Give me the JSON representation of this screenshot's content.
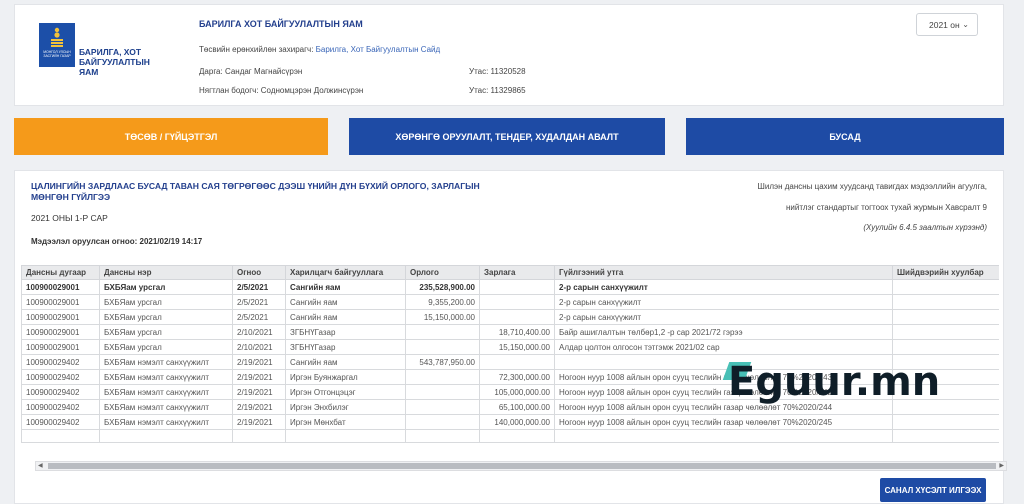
{
  "header": {
    "logo_text_1": "БАРИЛГА, ХОТ",
    "logo_text_2": "БАЙГУУЛАЛТЫН ЯАМ",
    "emblem_text": "МОНГОЛ УЛСЫН ЗАСГИЙН ГАЗАР",
    "org_name": "БАРИЛГА ХОТ БАЙГУУЛАЛТЫН ЯАМ",
    "manager_label": "Төсвийн ерөнхийлөн захирагч:",
    "manager_value": "Барилга, Хот Байгуулалтын Сайд",
    "head_label": "Дарга: Сандаг Магнайсүрэн",
    "head_phone": "Утас: 11320528",
    "accountant_label": "Нягтлан бодогч: Содномцэрэн Должинсүрэн",
    "accountant_phone": "Утас: 11329865",
    "year_value": "2021 он"
  },
  "tabs": [
    {
      "label": "ТӨСӨВ / ГҮЙЦЭТГЭЛ"
    },
    {
      "label": "ХӨРӨНГӨ ОРУУЛАЛТ, ТЕНДЕР, ХУДАЛДАН АВАЛТ"
    },
    {
      "label": "БУСАД"
    }
  ],
  "main": {
    "title": "ЦАЛИНГИЙН ЗАРДЛААС БУСАД ТАВАН САЯ ТӨГРӨГӨӨС ДЭЭШ ҮНИЙН ДҮН БҮХИЙ ОРЛОГО, ЗАРЛАГЫН МӨНГӨН ГҮЙЛГЭЭ",
    "subtitle": "2021 ОНЫ 1-Р САР",
    "updated": "Мэдээлэл оруулсан огноо: 2021/02/19 14:17",
    "note_1": "Шилэн дансны цахим хуудсанд тавигдах мэдээллийн агуулга,",
    "note_2": "нийтлэг стандартыг тогтоох тухай журмын Хавсралт 9",
    "note_3": "(Хуулийн 6.4.5 заалтын хүрээнд)",
    "submit_label": "САНАЛ ХҮСЭЛТ ИЛГЭЭХ"
  },
  "table": {
    "columns": [
      "Дансны дугаар",
      "Дансны нэр",
      "Огноо",
      "Харилцагч байгууллага",
      "Орлого",
      "Зарлага",
      "Гүйлгээний утга",
      "Шийдвэрийн хуулбар"
    ],
    "rows": [
      [
        "100900029001",
        "БХБЯам урсгал",
        "2/5/2021",
        "Сангийн яам",
        "235,528,900.00",
        "",
        "2-р сарын санхүүжилт",
        ""
      ],
      [
        "100900029001",
        "БХБЯам урсгал",
        "2/5/2021",
        "Сангийн яам",
        "9,355,200.00",
        "",
        "2-р сарын санхүүжилт",
        ""
      ],
      [
        "100900029001",
        "БХБЯам урсгал",
        "2/5/2021",
        "Сангийн яам",
        "15,150,000.00",
        "",
        "2-р сарын санхүүжилт",
        ""
      ],
      [
        "100900029001",
        "БХБЯам урсгал",
        "2/10/2021",
        "ЗГБНҮГазар",
        "",
        "18,710,400.00",
        "Байр ашиглалтын төлбөр1,2 -р сар 2021/72 гэрээ",
        ""
      ],
      [
        "100900029001",
        "БХБЯам урсгал",
        "2/10/2021",
        "ЗГБНҮГазар",
        "",
        "15,150,000.00",
        "Алдар цолтон олгосон тэтгэмж 2021/02 сар",
        ""
      ],
      [
        "100900029402",
        "БХБЯам нэмэлт санхүүжилт",
        "2/19/2021",
        "Сангийн яам",
        "543,787,950.00",
        "",
        "",
        ""
      ],
      [
        "100900029402",
        "БХБЯам нэмэлт санхүүжилт",
        "2/19/2021",
        "Иргэн Буянжаргал",
        "",
        "72,300,000.00",
        "Ногоон нуур 1008 айлын орон сууц теслийн газар чөлөөлөт 70%2020/243",
        ""
      ],
      [
        "100900029402",
        "БХБЯам нэмэлт санхүүжилт",
        "2/19/2021",
        "Иргэн Отгонцэцэг",
        "",
        "105,000,000.00",
        "Ногоон нуур 1008 айлын орон сууц теслийн газар чөлөөлөт 70%2020/242",
        ""
      ],
      [
        "100900029402",
        "БХБЯам нэмэлт санхүүжилт",
        "2/19/2021",
        "Иргэн Энхбилэг",
        "",
        "65,100,000.00",
        "Ногоон нуур 1008 айлын орон сууц теслийн газар чөлөөлөт 70%2020/244",
        ""
      ],
      [
        "100900029402",
        "БХБЯам нэмэлт санхүүжилт",
        "2/19/2021",
        "Иргэн Мөнхбат",
        "",
        "140,000,000.00",
        "Ногоон нуур 1008 айлын орон сууц теслийн газар чөлөөлөт 70%2020/245",
        ""
      ]
    ]
  },
  "watermark": "Eguur.mn"
}
